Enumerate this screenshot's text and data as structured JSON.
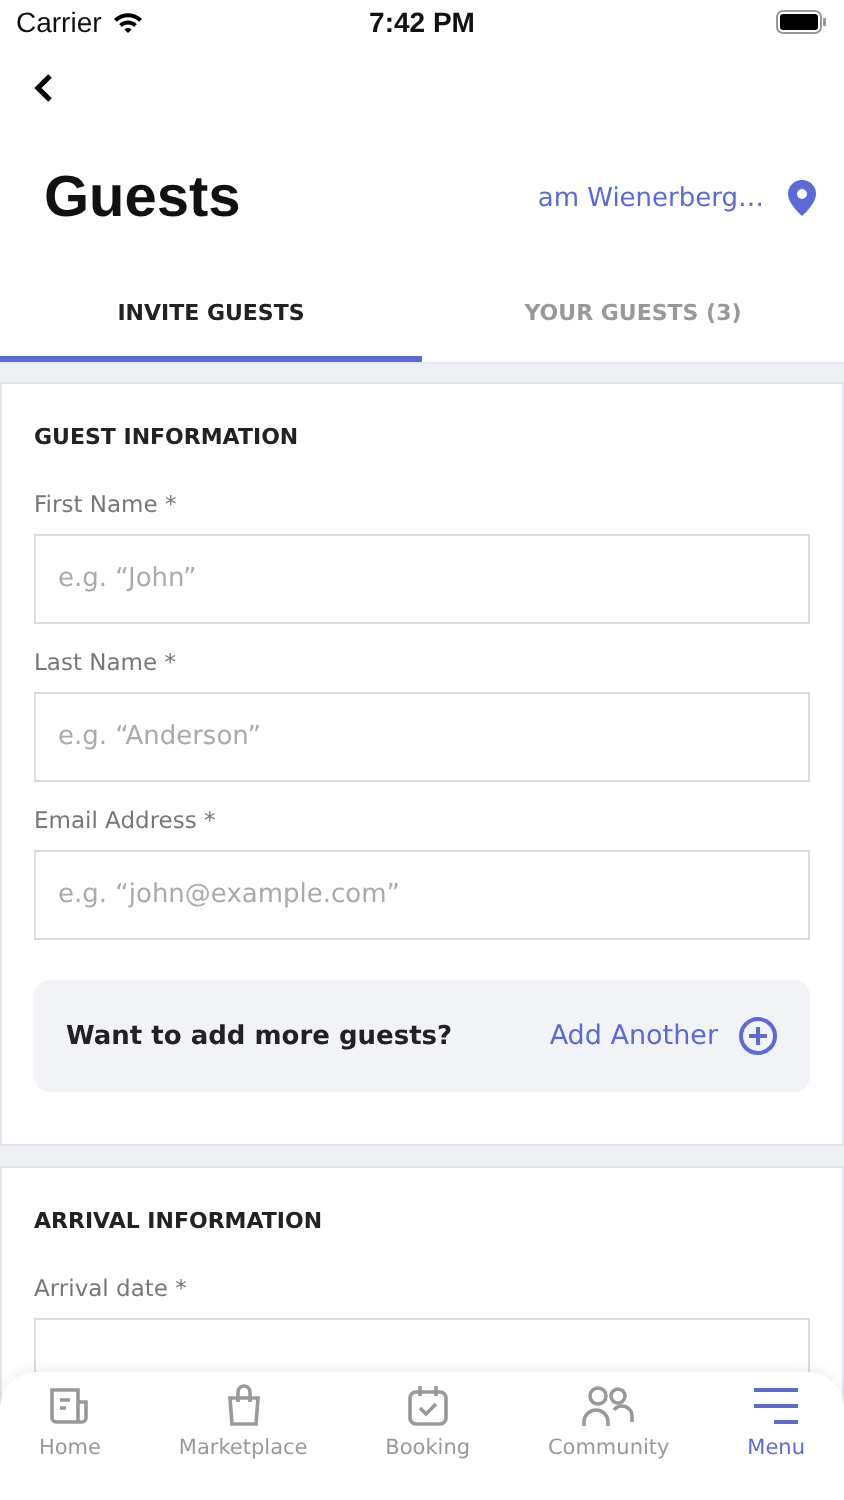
{
  "status_bar": {
    "carrier": "Carrier",
    "time": "7:42 PM"
  },
  "header": {
    "title": "Guests",
    "location": "am Wienerberg…"
  },
  "tabs": [
    {
      "label": "INVITE GUESTS",
      "selected": true
    },
    {
      "label": "YOUR GUESTS (3)",
      "selected": false
    }
  ],
  "guest_section": {
    "heading": "GUEST INFORMATION",
    "fields": [
      {
        "label": "First Name *",
        "placeholder": "e.g. “John”"
      },
      {
        "label": "Last Name *",
        "placeholder": "e.g. “Anderson”"
      },
      {
        "label": "Email Address *",
        "placeholder": "e.g. “john@example.com”"
      }
    ],
    "add_more": {
      "prompt": "Want to add more guests?",
      "action": "Add Another"
    }
  },
  "arrival_section": {
    "heading": "ARRIVAL INFORMATION",
    "fields": [
      {
        "label": "Arrival date *"
      }
    ]
  },
  "bottom_nav": [
    {
      "kind": "home",
      "label": "Home",
      "selected": false
    },
    {
      "kind": "bag",
      "label": "Marketplace",
      "selected": false
    },
    {
      "kind": "calendar",
      "label": "Booking",
      "selected": false
    },
    {
      "kind": "people",
      "label": "Community",
      "selected": false
    },
    {
      "kind": "menu",
      "label": "Menu",
      "selected": true
    }
  ]
}
